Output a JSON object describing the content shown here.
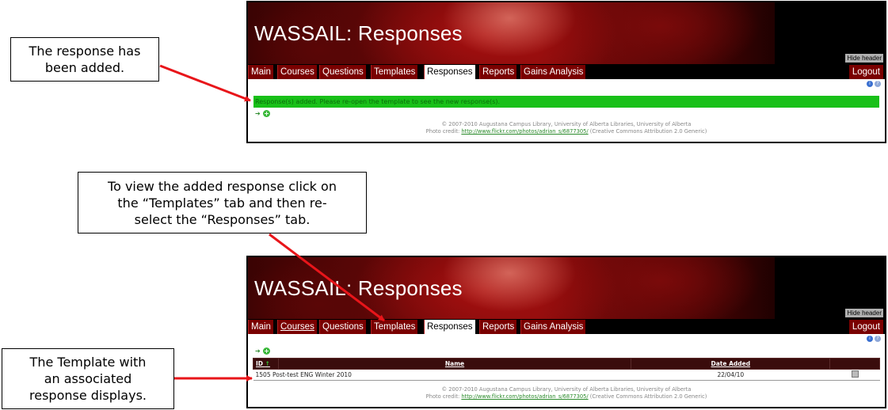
{
  "callouts": {
    "added": [
      "The response has",
      "been added."
    ],
    "view": [
      "To view the added response click  on",
      "the “Templates” tab and then re-",
      "select the “Responses” tab."
    ],
    "template": [
      "The Template with",
      "an associated",
      "response displays."
    ]
  },
  "app": {
    "title": "WASSAIL: Responses",
    "hide_header": "Hide header",
    "logout": "Logout",
    "tabs": [
      "Main",
      "Courses",
      "Questions",
      "Templates",
      "Responses",
      "Reports",
      "Gains Analysis"
    ],
    "active_tab": "Responses",
    "icons": {
      "info": "info-icon",
      "help": "help-icon",
      "go": "go-arrow-icon",
      "add": "add-icon",
      "template": "template-icon"
    }
  },
  "screen1": {
    "message": "Response(s) added. Please re-open the template to see the new response(s)."
  },
  "screen2": {
    "table": {
      "columns": [
        "ID",
        "Name",
        "Date Added",
        ""
      ],
      "sort_indicator": "↑",
      "rows": [
        {
          "id": "1505",
          "name": "Post-test ENG Winter 2010",
          "date_added": "22/04/10"
        }
      ]
    }
  },
  "footer": {
    "copyright": "© 2007-2010 Augustana Campus Library, University of Alberta Libraries, University of Alberta",
    "photo_prefix": "Photo credit: ",
    "photo_link": "http://www.flickr.com/photos/adrian_s/6877305/",
    "photo_suffix": " (Creative Commons Attribution 2.0 Generic)"
  },
  "colors": {
    "banner_red": "#7a0000",
    "success_green": "#18c018",
    "table_header": "#3a0c0c",
    "arrow": "#e8151a"
  }
}
